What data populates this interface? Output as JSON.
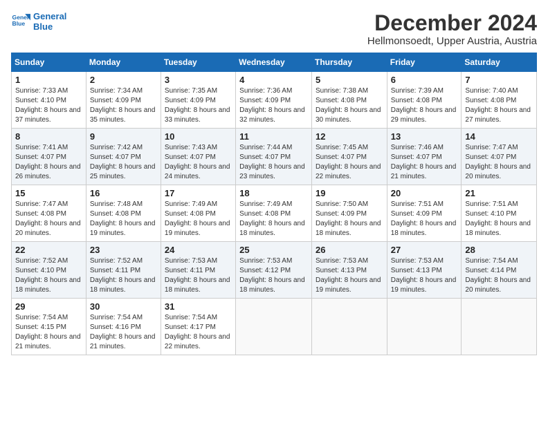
{
  "header": {
    "logo_line1": "General",
    "logo_line2": "Blue",
    "title": "December 2024",
    "location": "Hellmonsoedt, Upper Austria, Austria"
  },
  "weekdays": [
    "Sunday",
    "Monday",
    "Tuesday",
    "Wednesday",
    "Thursday",
    "Friday",
    "Saturday"
  ],
  "weeks": [
    [
      {
        "day": "1",
        "sunrise": "7:33 AM",
        "sunset": "4:10 PM",
        "daylight": "8 hours and 37 minutes."
      },
      {
        "day": "2",
        "sunrise": "7:34 AM",
        "sunset": "4:09 PM",
        "daylight": "8 hours and 35 minutes."
      },
      {
        "day": "3",
        "sunrise": "7:35 AM",
        "sunset": "4:09 PM",
        "daylight": "8 hours and 33 minutes."
      },
      {
        "day": "4",
        "sunrise": "7:36 AM",
        "sunset": "4:09 PM",
        "daylight": "8 hours and 32 minutes."
      },
      {
        "day": "5",
        "sunrise": "7:38 AM",
        "sunset": "4:08 PM",
        "daylight": "8 hours and 30 minutes."
      },
      {
        "day": "6",
        "sunrise": "7:39 AM",
        "sunset": "4:08 PM",
        "daylight": "8 hours and 29 minutes."
      },
      {
        "day": "7",
        "sunrise": "7:40 AM",
        "sunset": "4:08 PM",
        "daylight": "8 hours and 27 minutes."
      }
    ],
    [
      {
        "day": "8",
        "sunrise": "7:41 AM",
        "sunset": "4:07 PM",
        "daylight": "8 hours and 26 minutes."
      },
      {
        "day": "9",
        "sunrise": "7:42 AM",
        "sunset": "4:07 PM",
        "daylight": "8 hours and 25 minutes."
      },
      {
        "day": "10",
        "sunrise": "7:43 AM",
        "sunset": "4:07 PM",
        "daylight": "8 hours and 24 minutes."
      },
      {
        "day": "11",
        "sunrise": "7:44 AM",
        "sunset": "4:07 PM",
        "daylight": "8 hours and 23 minutes."
      },
      {
        "day": "12",
        "sunrise": "7:45 AM",
        "sunset": "4:07 PM",
        "daylight": "8 hours and 22 minutes."
      },
      {
        "day": "13",
        "sunrise": "7:46 AM",
        "sunset": "4:07 PM",
        "daylight": "8 hours and 21 minutes."
      },
      {
        "day": "14",
        "sunrise": "7:47 AM",
        "sunset": "4:07 PM",
        "daylight": "8 hours and 20 minutes."
      }
    ],
    [
      {
        "day": "15",
        "sunrise": "7:47 AM",
        "sunset": "4:08 PM",
        "daylight": "8 hours and 20 minutes."
      },
      {
        "day": "16",
        "sunrise": "7:48 AM",
        "sunset": "4:08 PM",
        "daylight": "8 hours and 19 minutes."
      },
      {
        "day": "17",
        "sunrise": "7:49 AM",
        "sunset": "4:08 PM",
        "daylight": "8 hours and 19 minutes."
      },
      {
        "day": "18",
        "sunrise": "7:49 AM",
        "sunset": "4:08 PM",
        "daylight": "8 hours and 18 minutes."
      },
      {
        "day": "19",
        "sunrise": "7:50 AM",
        "sunset": "4:09 PM",
        "daylight": "8 hours and 18 minutes."
      },
      {
        "day": "20",
        "sunrise": "7:51 AM",
        "sunset": "4:09 PM",
        "daylight": "8 hours and 18 minutes."
      },
      {
        "day": "21",
        "sunrise": "7:51 AM",
        "sunset": "4:10 PM",
        "daylight": "8 hours and 18 minutes."
      }
    ],
    [
      {
        "day": "22",
        "sunrise": "7:52 AM",
        "sunset": "4:10 PM",
        "daylight": "8 hours and 18 minutes."
      },
      {
        "day": "23",
        "sunrise": "7:52 AM",
        "sunset": "4:11 PM",
        "daylight": "8 hours and 18 minutes."
      },
      {
        "day": "24",
        "sunrise": "7:53 AM",
        "sunset": "4:11 PM",
        "daylight": "8 hours and 18 minutes."
      },
      {
        "day": "25",
        "sunrise": "7:53 AM",
        "sunset": "4:12 PM",
        "daylight": "8 hours and 18 minutes."
      },
      {
        "day": "26",
        "sunrise": "7:53 AM",
        "sunset": "4:13 PM",
        "daylight": "8 hours and 19 minutes."
      },
      {
        "day": "27",
        "sunrise": "7:53 AM",
        "sunset": "4:13 PM",
        "daylight": "8 hours and 19 minutes."
      },
      {
        "day": "28",
        "sunrise": "7:54 AM",
        "sunset": "4:14 PM",
        "daylight": "8 hours and 20 minutes."
      }
    ],
    [
      {
        "day": "29",
        "sunrise": "7:54 AM",
        "sunset": "4:15 PM",
        "daylight": "8 hours and 21 minutes."
      },
      {
        "day": "30",
        "sunrise": "7:54 AM",
        "sunset": "4:16 PM",
        "daylight": "8 hours and 21 minutes."
      },
      {
        "day": "31",
        "sunrise": "7:54 AM",
        "sunset": "4:17 PM",
        "daylight": "8 hours and 22 minutes."
      },
      null,
      null,
      null,
      null
    ]
  ]
}
